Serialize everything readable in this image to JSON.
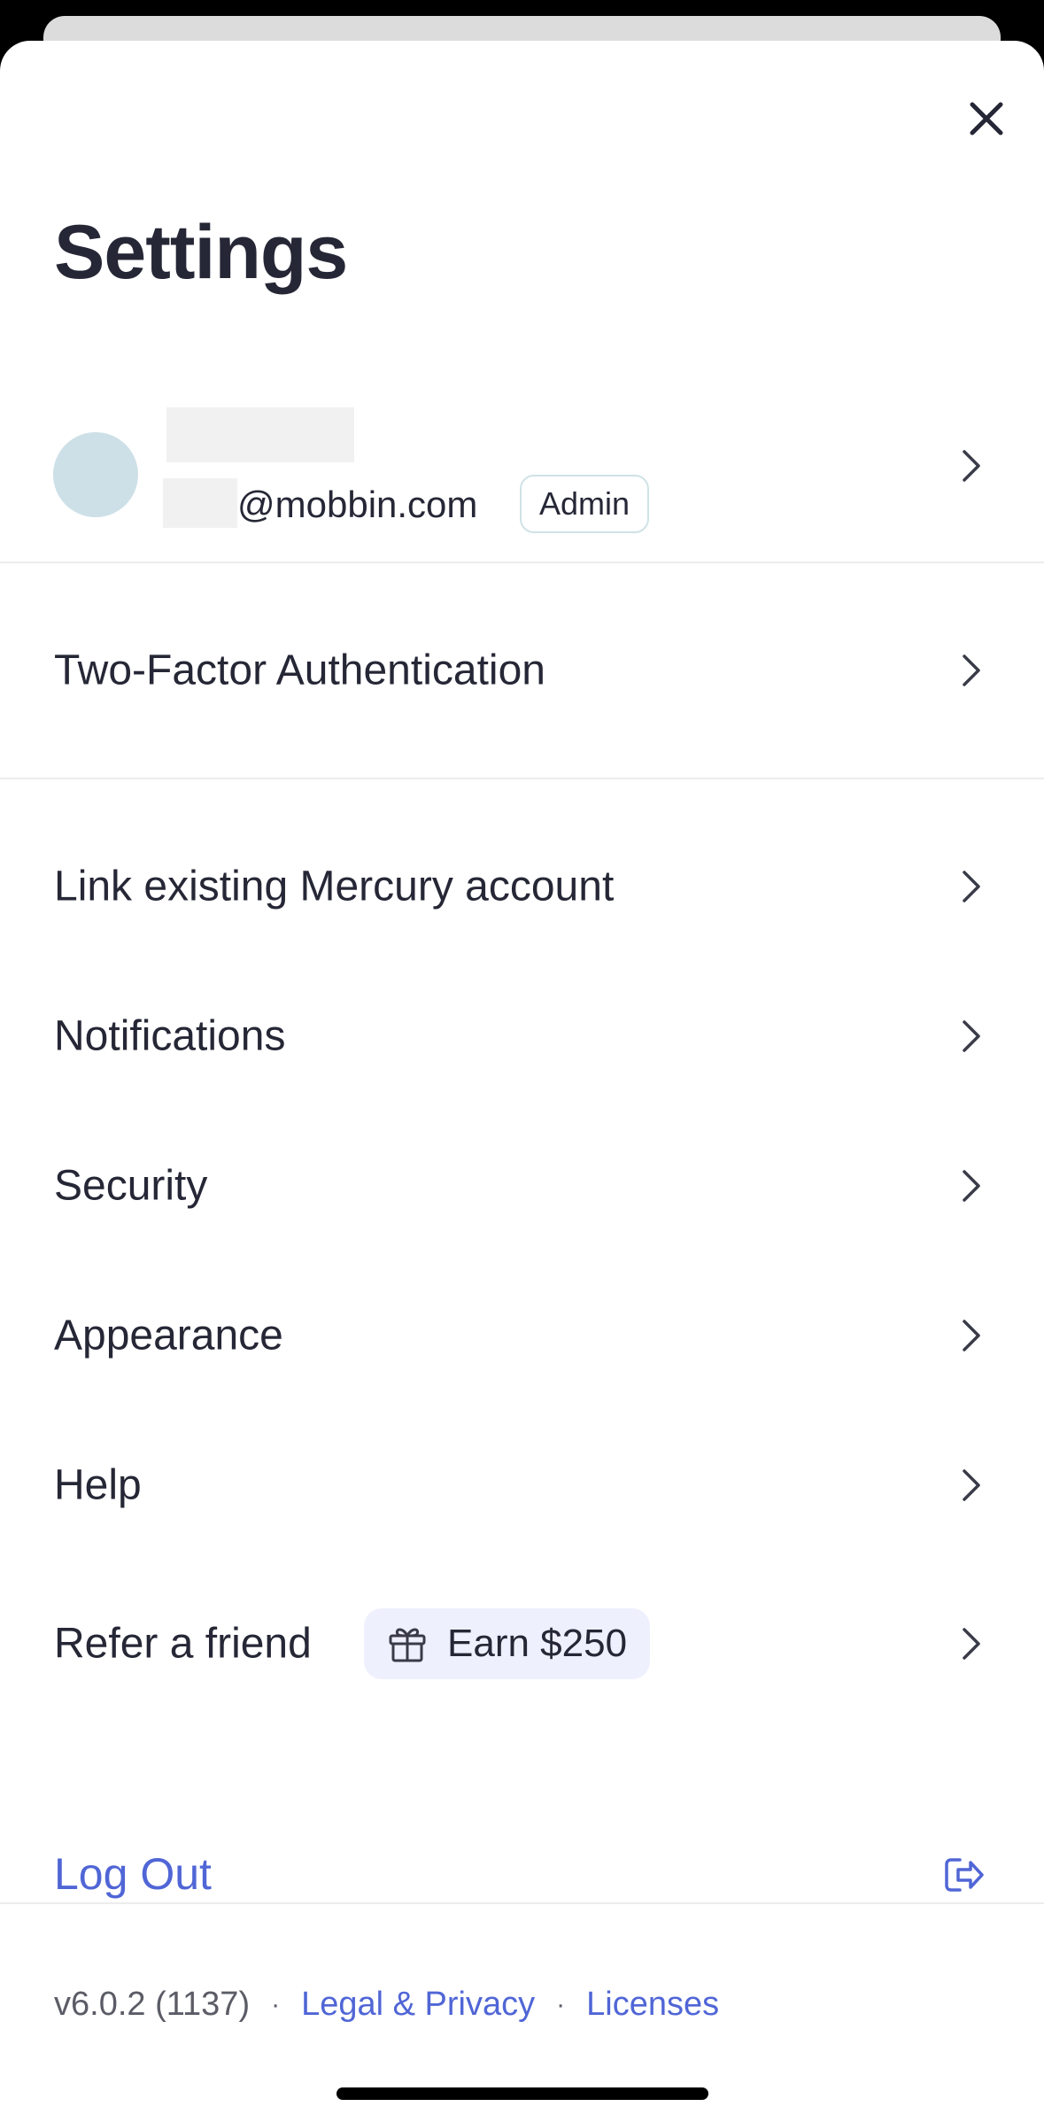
{
  "header": {
    "title": "Settings"
  },
  "profile": {
    "email_suffix": "@mobbin.com",
    "role_badge": "Admin"
  },
  "menu": {
    "two_factor": "Two-Factor Authentication",
    "link_account": "Link existing Mercury account",
    "notifications": "Notifications",
    "security": "Security",
    "appearance": "Appearance",
    "help": "Help",
    "refer": "Refer a friend",
    "refer_badge": "Earn $250"
  },
  "logout": {
    "label": "Log Out"
  },
  "footer": {
    "version": "v6.0.2 (1137)",
    "separator": "·",
    "legal": "Legal & Privacy",
    "licenses": "Licenses"
  },
  "colors": {
    "accent": "#5066d6",
    "text": "#262736",
    "badge_bg": "#eef0fd",
    "avatar": "#cde0e8"
  },
  "icons": {
    "close": "close-icon",
    "chevron": "chevron-right-icon",
    "gift": "gift-icon",
    "logout": "logout-icon"
  }
}
